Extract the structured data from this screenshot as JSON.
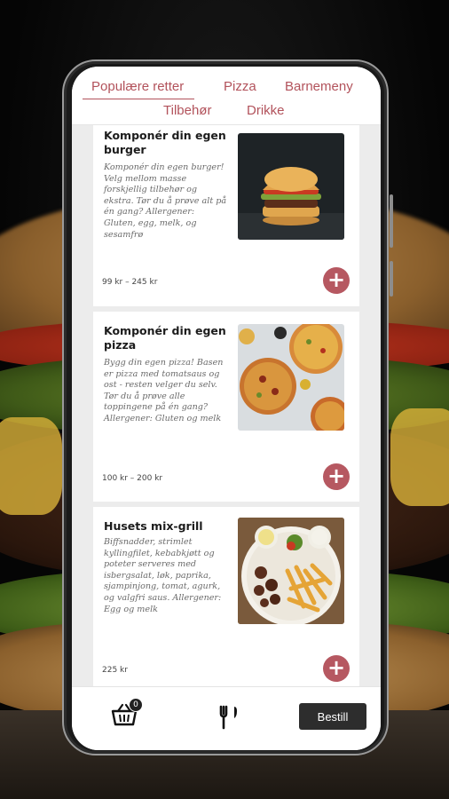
{
  "tabs": [
    {
      "label": "Populære retter"
    },
    {
      "label": "Pizza"
    },
    {
      "label": "Barnemeny"
    },
    {
      "label": "Tilbehør"
    },
    {
      "label": "Drikke"
    }
  ],
  "active_tab": "Populære retter",
  "products": [
    {
      "title": "Komponér din egen burger",
      "description": "Komponér din egen burger! Velg mellom masse forskjellig tilbehør og ekstra. Tør du å prøve alt på én gang? Allergener: Gluten, egg, melk, og sesamfrø",
      "price": "99 kr – 245 kr",
      "image_icon": "burger-photo"
    },
    {
      "title": "Komponér din egen pizza",
      "description": "Bygg din egen pizza! Basen er pizza med tomatsaus og ost - resten velger du selv. Tør du å prøve alle toppingene på én gang? Allergener: Gluten og melk",
      "price": "100 kr – 200 kr",
      "image_icon": "pizza-photo"
    },
    {
      "title": "Husets mix-grill",
      "description": "Biffsnadder, strimlet kyllingfilet, kebabkjøtt og poteter serveres med isbergsalat, løk, paprika, sjampinjong, tomat, agurk, og valgfri saus. Allergener: Egg og melk",
      "price": "225 kr",
      "image_icon": "mixgrill-photo"
    }
  ],
  "add_icon": "plus-icon",
  "bottom_bar": {
    "cart_count": "0",
    "cart_icon": "basket-icon",
    "menu_icon": "cutlery-icon",
    "order_label": "Bestill"
  },
  "colors": {
    "accent": "#b65861",
    "tab_text": "#b2525b",
    "order_button": "#2d2d2d"
  }
}
